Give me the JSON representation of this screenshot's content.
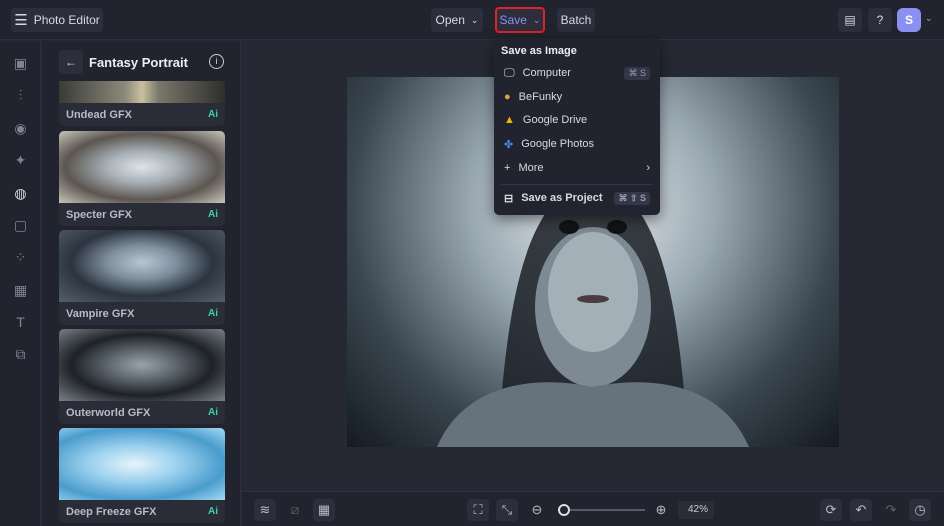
{
  "topbar": {
    "app_title": "Photo Editor",
    "open": "Open",
    "save": "Save",
    "batch": "Batch",
    "avatar": "S"
  },
  "panel": {
    "title": "Fantasy Portrait",
    "items": [
      {
        "label": "Undead GFX",
        "badge": "Ai"
      },
      {
        "label": "Specter GFX",
        "badge": "Ai"
      },
      {
        "label": "Vampire GFX",
        "badge": "Ai"
      },
      {
        "label": "Outerworld GFX",
        "badge": "Ai"
      },
      {
        "label": "Deep Freeze GFX",
        "badge": "Ai"
      }
    ]
  },
  "save_menu": {
    "heading": "Save as Image",
    "items": [
      {
        "label": "Computer",
        "shortcut": "⌘ S"
      },
      {
        "label": "BeFunky"
      },
      {
        "label": "Google Drive"
      },
      {
        "label": "Google Photos"
      },
      {
        "label": "More"
      }
    ],
    "project": {
      "label": "Save as Project",
      "shortcut": "⌘ ⇧ S"
    }
  },
  "bottombar": {
    "zoom": "42%",
    "zoom_fraction": 0.05
  },
  "colors": {
    "accent": "#8b8ff0",
    "highlight": "#e0202a",
    "ai": "#3fd0a8"
  }
}
